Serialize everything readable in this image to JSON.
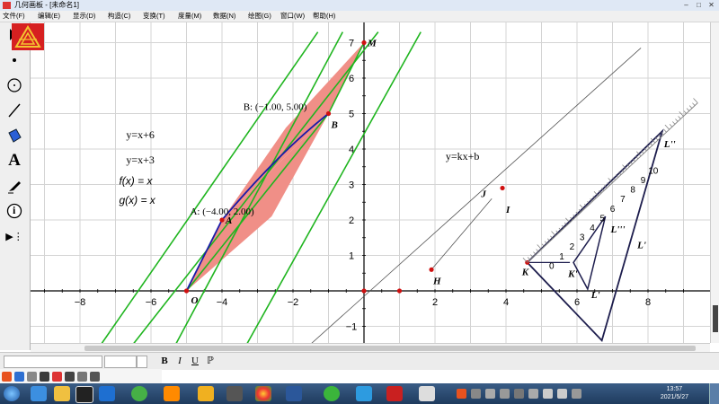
{
  "window": {
    "title": "几何画板 - [未命名1]"
  },
  "menu": [
    "文件(F)",
    "编辑(E)",
    "显示(D)",
    "构造(C)",
    "变换(T)",
    "度量(M)",
    "数据(N)",
    "绘图(G)",
    "窗口(W)",
    "帮助(H)"
  ],
  "toolbox": [
    {
      "name": "arrow-select-tool",
      "icon": "arrow-icon"
    },
    {
      "name": "point-tool",
      "icon": "point-icon"
    },
    {
      "name": "compass-tool",
      "icon": "circle-icon"
    },
    {
      "name": "straightedge-tool",
      "icon": "segment-icon"
    },
    {
      "name": "polygon-tool",
      "icon": "polygon-icon"
    },
    {
      "name": "text-tool",
      "icon": "text-icon",
      "glyph": "A"
    },
    {
      "name": "marker-tool",
      "icon": "marker-icon"
    },
    {
      "name": "information-tool",
      "icon": "info-icon",
      "glyph": "i"
    },
    {
      "name": "custom-tool",
      "icon": "custom-tool-icon",
      "glyph": "▶⋮"
    }
  ],
  "graph": {
    "axis_ticks_x": [
      "−8",
      "−6",
      "−4",
      "−2",
      "2",
      "4",
      "6",
      "8"
    ],
    "axis_ticks_y": [
      "−1",
      "1",
      "2",
      "3",
      "4",
      "5",
      "6",
      "7"
    ],
    "equations": [
      "y=x+6",
      "y=x+3"
    ],
    "functions": [
      "f(x) = x",
      "g(x) = x"
    ],
    "line_equation": "y=kx+b",
    "coord_A": "A: (−4.00, 2.00)",
    "coord_B": "B: (−1.00, 5.00)",
    "point_labels": {
      "A": "A",
      "B": "B",
      "M": "M",
      "O": "O",
      "H": "H",
      "I": "I",
      "J": "J",
      "K": "K",
      "K'": "K'",
      "L'": "L'",
      "L''": "L''",
      "L'''": "L'''"
    },
    "ruler_ticks": [
      "0",
      "1",
      "2",
      "3",
      "4",
      "5",
      "6",
      "7",
      "8",
      "9",
      "10"
    ],
    "ruler_labels": [
      {
        "text": "L''"
      },
      {
        "text": "L'''"
      },
      {
        "text": "L'"
      },
      {
        "text": "K'"
      },
      {
        "text": "L'"
      }
    ],
    "colors": {
      "grid": "#d4d4d4",
      "green": "#1fb51f",
      "fill": "#f08f87",
      "blue": "#1a1aa8",
      "point": "#d01010",
      "navy": "#1d1d4d"
    }
  },
  "format_bar": {
    "bold": "B",
    "italic": "I",
    "underline": "U",
    "symbol": "ℙ"
  },
  "taskbar": {
    "time": "13:57",
    "date": "2021/5/27"
  }
}
